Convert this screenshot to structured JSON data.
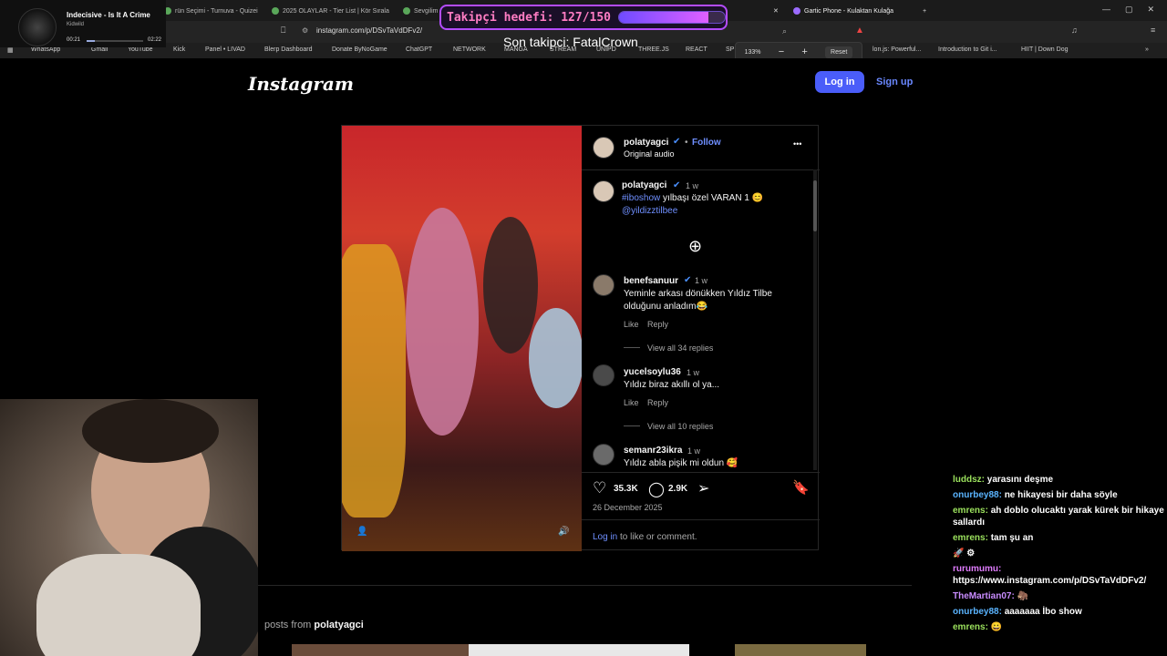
{
  "browser": {
    "tabs": [
      "Indecisive - Is It A Crime",
      "rün Seçimi - Turnuva - Quizei",
      "2025 OLAYLAR - Tier List | Kör Sırala",
      "Sevgilim",
      "Gartic Phone - Kulaktan Kulağa"
    ],
    "url": "instagram.com/p/DSvTaVdDFv2/",
    "zoom_level": "133%",
    "zoom_reset": "Reset",
    "bookmarks": [
      "WhatsApp",
      "Gmail",
      "YouTube",
      "Kick",
      "Panel • LIVAD",
      "Blerp Dashboard",
      "Donate ByNoGame",
      "ChatGPT",
      "NETWORK",
      "MANGA",
      "STREAM",
      "UNIPD",
      "THREE.JS",
      "REACT",
      "SP",
      "lon.js: Powerful...",
      "Introduction to Git i...",
      "HIIT | Down Dog"
    ]
  },
  "music": {
    "title": "Indecisive - Is It A Crime",
    "artist": "Kidwild",
    "time_current": "00:21",
    "time_total": "02:22",
    "progress": 0.15
  },
  "header": {
    "logo": "Instagram",
    "login": "Log in",
    "signup": "Sign up"
  },
  "post": {
    "author": "polatyagci",
    "follow": "Follow",
    "audio": "Original audio",
    "more": "•••",
    "caption": {
      "user": "polatyagci",
      "time": "1 w",
      "hashtag": "#iboshow",
      "text": " yılbaşı özel VARAN 1 😊",
      "mention": "@yildizztilbee"
    },
    "comments": [
      {
        "user": "benefsanuur",
        "time": "1 w",
        "text1": "Yeminle arkası dönükken Yıldız Tilbe",
        "text2": "olduğunu anladım😂",
        "like": "Like",
        "reply": "Reply",
        "replies": "View all 34 replies"
      },
      {
        "user": "yucelsoylu36",
        "time": "1 w",
        "text1": "Yıldız biraz akıllı ol ya...",
        "like": "Like",
        "reply": "Reply",
        "replies": "View all 10 replies"
      },
      {
        "user": "semanr23ikra",
        "time": "1 w",
        "text1": "Yıldız abla pişik mi oldun 🥰"
      }
    ],
    "likes": "35.3K",
    "comments_count": "2.9K",
    "date": "26 December 2025",
    "login_prompt": "Log in",
    "login_rest": " to like or comment."
  },
  "more_posts": {
    "prefix": "posts from",
    "user": "polatyagci"
  },
  "stream": {
    "goal": "Takipçi hedefi: 127/150",
    "goal_progress": 0.8467,
    "last_follower": "Son takipci: FatalCrown"
  },
  "chat": [
    {
      "user": "luddsz",
      "color": "#9be15d",
      "msg": "yarasını deşme"
    },
    {
      "user": "onurbey88",
      "color": "#5ab4ff",
      "msg": "ne hikayesi bir daha söyle"
    },
    {
      "user": "emrens",
      "color": "#9be15d",
      "msg": "ah doblo olucaktı yarak kürek bir hikaye sallardı"
    },
    {
      "user": "emrens",
      "color": "#9be15d",
      "msg": "tam şu an"
    },
    {
      "user": "",
      "color": "#ffffff",
      "msg": "🚀 ⚙"
    },
    {
      "user": "rurumumu",
      "color": "#e07cff",
      "msg": "https://www.instagram.com/p/DSvTaVdDFv2/"
    },
    {
      "user": "TheMartian07",
      "color": "#c98cff",
      "msg": "🦣"
    },
    {
      "user": "onurbey88",
      "color": "#5ab4ff",
      "msg": "aaaaaaa İbo show"
    },
    {
      "user": "emrens",
      "color": "#9be15d",
      "msg": "😀"
    }
  ]
}
